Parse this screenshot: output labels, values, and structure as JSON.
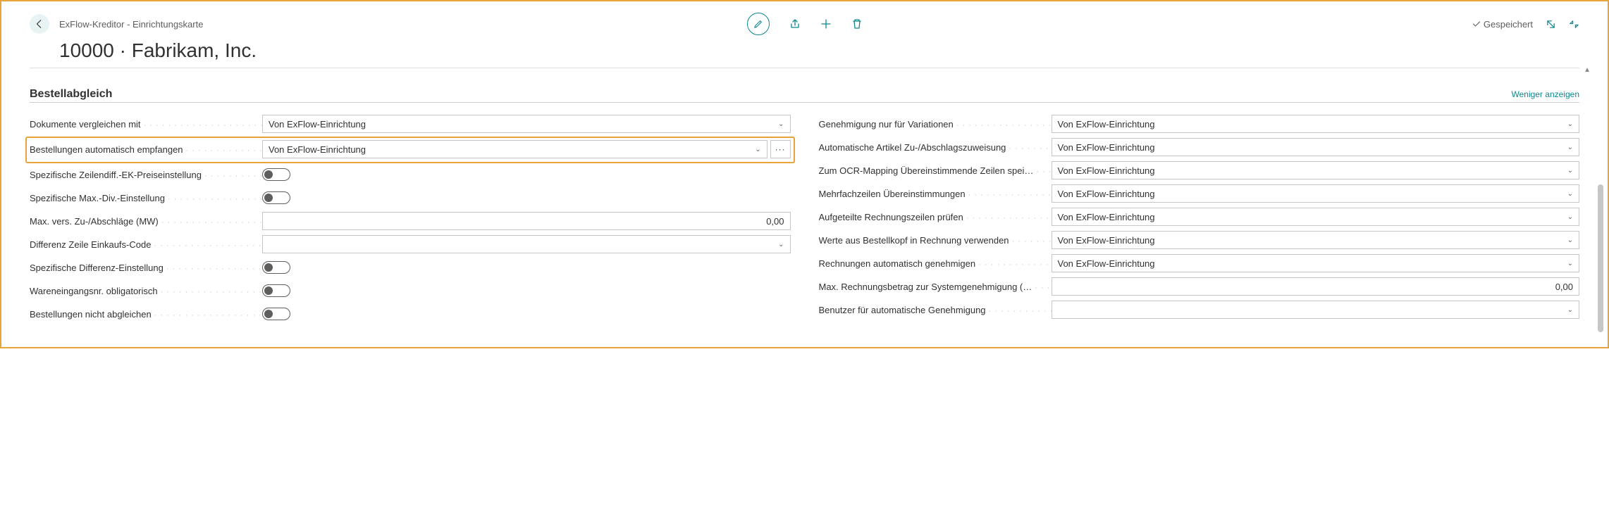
{
  "header": {
    "breadcrumb": "ExFlow-Kreditor - Einrichtungskarte",
    "title": "10000 · Fabrikam, Inc.",
    "saved_label": "Gespeichert"
  },
  "section": {
    "title": "Bestellabgleich",
    "show_less": "Weniger anzeigen"
  },
  "left": {
    "r0": {
      "label": "Dokumente vergleichen mit",
      "value": "Von ExFlow-Einrichtung"
    },
    "r1": {
      "label": "Bestellungen automatisch empfangen",
      "value": "Von ExFlow-Einrichtung"
    },
    "r2": {
      "label": "Spezifische Zeilendiff.-EK-Preiseinstellung"
    },
    "r3": {
      "label": "Spezifische Max.-Div.-Einstellung"
    },
    "r4": {
      "label": "Max. vers. Zu-/Abschläge (MW)",
      "value": "0,00"
    },
    "r5": {
      "label": "Differenz Zeile Einkaufs-Code",
      "value": ""
    },
    "r6": {
      "label": "Spezifische Differenz-Einstellung"
    },
    "r7": {
      "label": "Wareneingangsnr. obligatorisch"
    },
    "r8": {
      "label": "Bestellungen nicht abgleichen"
    }
  },
  "right": {
    "r0": {
      "label": "Genehmigung nur für Variationen",
      "value": "Von ExFlow-Einrichtung"
    },
    "r1": {
      "label": "Automatische Artikel Zu-/Abschlagszuweisung",
      "value": "Von ExFlow-Einrichtung"
    },
    "r2": {
      "label": "Zum OCR-Mapping Übereinstimmende Zeilen spei…",
      "value": "Von ExFlow-Einrichtung"
    },
    "r3": {
      "label": "Mehrfachzeilen Übereinstimmungen",
      "value": "Von ExFlow-Einrichtung"
    },
    "r4": {
      "label": "Aufgeteilte Rechnungszeilen prüfen",
      "value": "Von ExFlow-Einrichtung"
    },
    "r5": {
      "label": "Werte aus Bestellkopf in Rechnung verwenden",
      "value": "Von ExFlow-Einrichtung"
    },
    "r6": {
      "label": "Rechnungen automatisch genehmigen",
      "value": "Von ExFlow-Einrichtung"
    },
    "r7": {
      "label": "Max. Rechnungsbetrag zur Systemgenehmigung (…",
      "value": "0,00"
    },
    "r8": {
      "label": "Benutzer für automatische Genehmigung",
      "value": ""
    }
  }
}
